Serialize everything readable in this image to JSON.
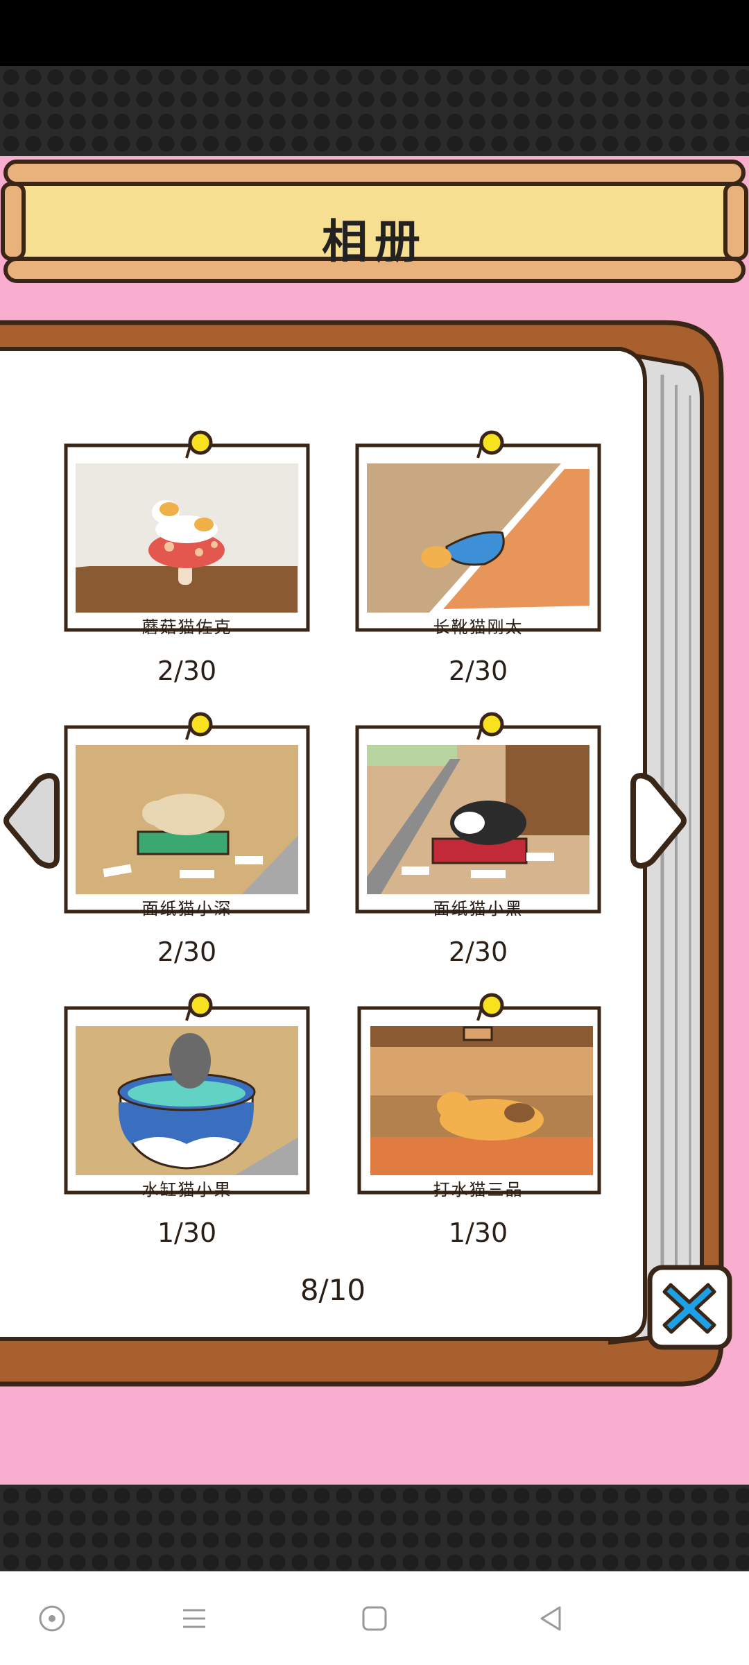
{
  "title": "相册",
  "cards": [
    {
      "name": "蘑菇猫佐克",
      "count": "2/30"
    },
    {
      "name": "长靴猫刚太",
      "count": "2/30"
    },
    {
      "name": "面纸猫小深",
      "count": "2/30"
    },
    {
      "name": "面纸猫小黑",
      "count": "2/30"
    },
    {
      "name": "水缸猫小果",
      "count": "1/30"
    },
    {
      "name": "打水猫三品",
      "count": "1/30"
    }
  ],
  "page_indicator": "8/10",
  "icons": {
    "prev": "triangle-left-icon",
    "next": "triangle-right-icon",
    "close": "close-x-icon",
    "nav": [
      "circle-dot-icon",
      "menu-lines-icon",
      "square-icon",
      "back-triangle-icon"
    ]
  },
  "colors": {
    "background": "#f9aed0",
    "wood": "#a8612e",
    "title_fill": "#f7df92",
    "close_x": "#1ea0e6",
    "pin": "#f8e11f"
  }
}
